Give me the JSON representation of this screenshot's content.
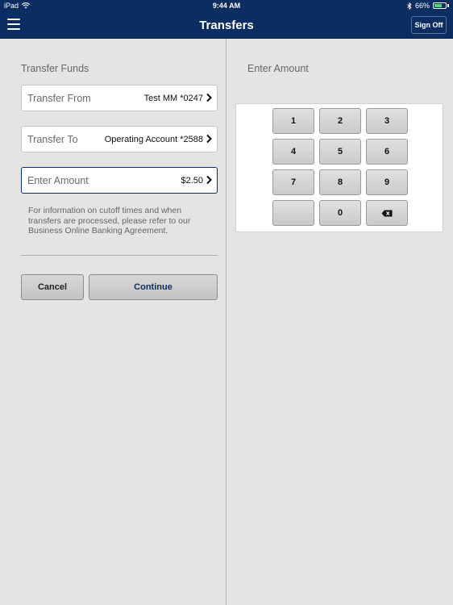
{
  "status_bar": {
    "device": "iPad",
    "time": "9:44 AM",
    "battery_percent": "66%",
    "battery_level": 0.66,
    "icons": [
      "wifi-icon",
      "bluetooth-icon",
      "battery-icon"
    ]
  },
  "nav": {
    "title": "Transfers",
    "sign_off_label": "Sign Off",
    "menu_icon": "hamburger-menu-icon"
  },
  "transfer_form": {
    "section_title": "Transfer Funds",
    "from": {
      "label": "Transfer From",
      "value": "Test MM *0247"
    },
    "to": {
      "label": "Transfer To",
      "value": "Operating Account *2588"
    },
    "amount": {
      "label": "Enter Amount",
      "value": "$2.50"
    },
    "info_text": "For information on cutoff times and when transfers are processed, please refer to our Business Online Banking Agreement.",
    "cancel_label": "Cancel",
    "continue_label": "Continue"
  },
  "keypad": {
    "title": "Enter Amount",
    "keys": [
      "1",
      "2",
      "3",
      "4",
      "5",
      "6",
      "7",
      "8",
      "9",
      "",
      "0"
    ],
    "backspace_icon": "backspace-icon"
  },
  "colors": {
    "header_bg": "#0c2d62",
    "panel_bg": "#e4e4e4",
    "accent": "#0c2d62"
  }
}
